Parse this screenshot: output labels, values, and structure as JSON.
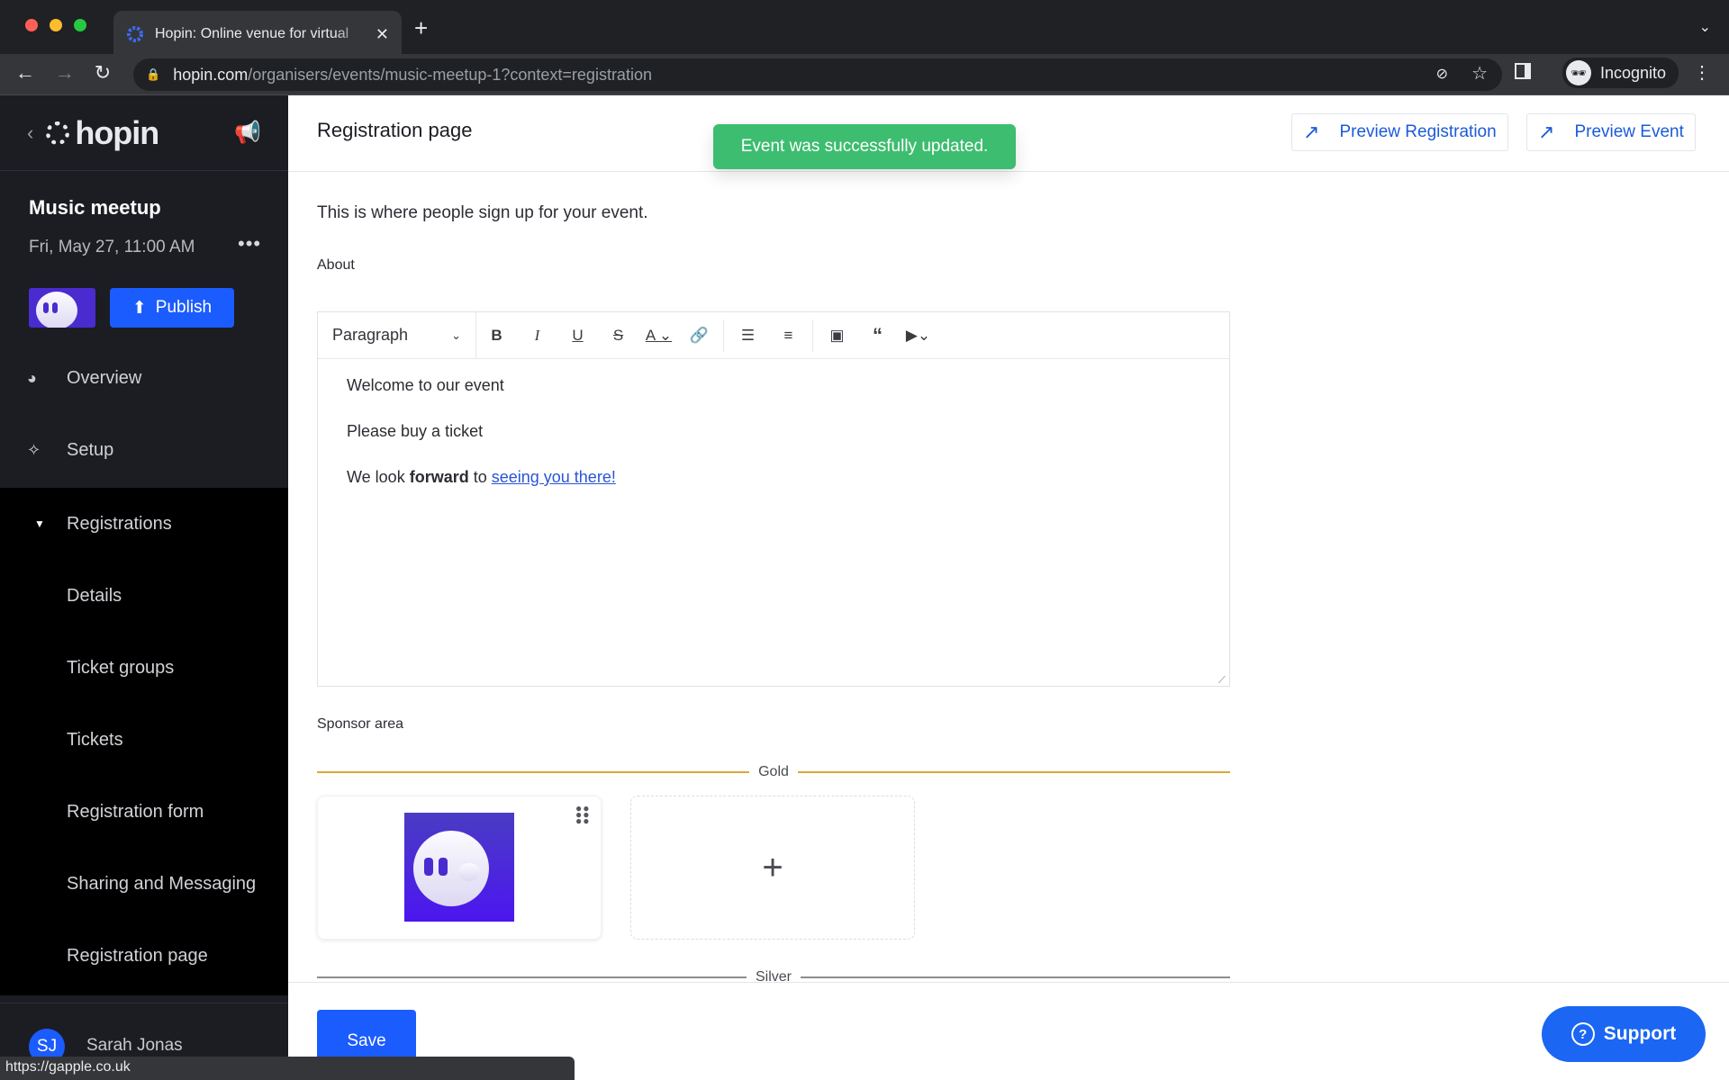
{
  "browser": {
    "tab_title": "Hopin: Online venue for virtual",
    "url_host": "hopin.com",
    "url_path": "/organisers/events/music-meetup-1?context=registration",
    "profile_label": "Incognito",
    "status_url": "https://gapple.co.uk"
  },
  "sidebar": {
    "brand": "hopin",
    "event_name": "Music meetup",
    "event_date": "Fri, May 27, 11:00 AM",
    "publish_label": "Publish",
    "nav": [
      {
        "label": "Overview",
        "icon": "pie-chart-icon"
      },
      {
        "label": "Setup",
        "icon": "magic-wand-icon"
      },
      {
        "label": "Registrations",
        "icon": "caret-down-icon"
      }
    ],
    "subnav": [
      "Details",
      "Ticket groups",
      "Tickets",
      "Registration form",
      "Sharing and Messaging",
      "Registration page"
    ],
    "user": {
      "initials": "SJ",
      "name": "Sarah Jonas"
    }
  },
  "header": {
    "title": "Registration page",
    "toast": "Event was successfully updated.",
    "preview_registration": "Preview Registration",
    "preview_event": "Preview Event"
  },
  "content": {
    "subtitle": "This is where people sign up for your event.",
    "about_label": "About",
    "editor": {
      "block_type": "Paragraph",
      "line1": "Welcome to our event",
      "line2": "Please buy a ticket",
      "line3_pre": "We look ",
      "line3_bold": "forward",
      "line3_mid": " to ",
      "line3_link": "seeing you there!"
    },
    "sponsor_label": "Sponsor area",
    "tiers": [
      {
        "name": "Gold",
        "color": "#d8a935"
      },
      {
        "name": "Silver",
        "color": "#8c8d91"
      }
    ],
    "save_label": "Save",
    "support_label": "Support"
  },
  "colors": {
    "accent": "#1b5cff",
    "toast": "#3dbd6f",
    "link": "#2a54d6"
  }
}
